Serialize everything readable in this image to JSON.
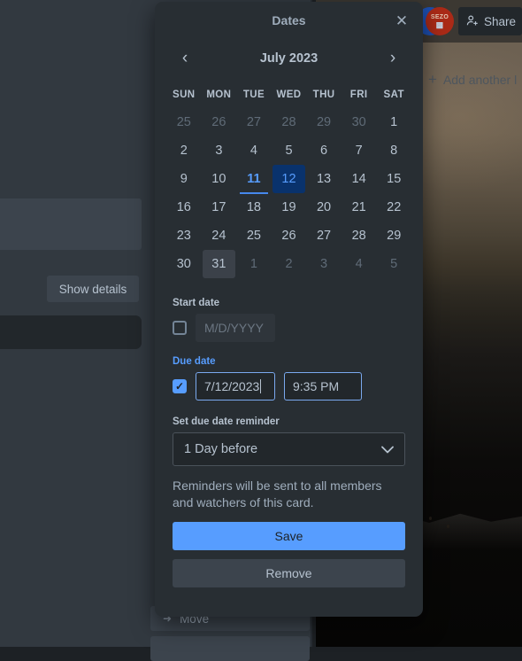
{
  "background": {
    "share_label": "Share",
    "share_icon": "person-plus-icon",
    "add_another_label": "Add another l",
    "add_another_icon": "plus-icon",
    "show_details_label": "Show details",
    "avatar_red_initials": "SEZO",
    "avatar_red_crest": "▩",
    "menu_items": [
      {
        "label": "Move",
        "icon": "arrow-right-icon"
      },
      {
        "label": "",
        "icon": ""
      }
    ]
  },
  "popup": {
    "title": "Dates",
    "close_icon": "close-icon",
    "calendar": {
      "month_label": "July 2023",
      "prev_icon": "chevron-left-icon",
      "next_icon": "chevron-right-icon",
      "weekdays": [
        "SUN",
        "MON",
        "TUE",
        "WED",
        "THU",
        "FRI",
        "SAT"
      ],
      "weeks": [
        [
          {
            "d": "25",
            "state": "muted"
          },
          {
            "d": "26",
            "state": "muted"
          },
          {
            "d": "27",
            "state": "muted"
          },
          {
            "d": "28",
            "state": "muted"
          },
          {
            "d": "29",
            "state": "muted"
          },
          {
            "d": "30",
            "state": "muted"
          },
          {
            "d": "1",
            "state": "normal"
          }
        ],
        [
          {
            "d": "2",
            "state": "normal"
          },
          {
            "d": "3",
            "state": "normal"
          },
          {
            "d": "4",
            "state": "normal"
          },
          {
            "d": "5",
            "state": "normal"
          },
          {
            "d": "6",
            "state": "normal"
          },
          {
            "d": "7",
            "state": "normal"
          },
          {
            "d": "8",
            "state": "normal"
          }
        ],
        [
          {
            "d": "9",
            "state": "normal"
          },
          {
            "d": "10",
            "state": "normal"
          },
          {
            "d": "11",
            "state": "today"
          },
          {
            "d": "12",
            "state": "selected"
          },
          {
            "d": "13",
            "state": "normal"
          },
          {
            "d": "14",
            "state": "normal"
          },
          {
            "d": "15",
            "state": "normal"
          }
        ],
        [
          {
            "d": "16",
            "state": "normal"
          },
          {
            "d": "17",
            "state": "normal"
          },
          {
            "d": "18",
            "state": "normal"
          },
          {
            "d": "19",
            "state": "normal"
          },
          {
            "d": "20",
            "state": "normal"
          },
          {
            "d": "21",
            "state": "normal"
          },
          {
            "d": "22",
            "state": "normal"
          }
        ],
        [
          {
            "d": "23",
            "state": "normal"
          },
          {
            "d": "24",
            "state": "normal"
          },
          {
            "d": "25",
            "state": "normal"
          },
          {
            "d": "26",
            "state": "normal"
          },
          {
            "d": "27",
            "state": "normal"
          },
          {
            "d": "28",
            "state": "normal"
          },
          {
            "d": "29",
            "state": "normal"
          }
        ],
        [
          {
            "d": "30",
            "state": "normal"
          },
          {
            "d": "31",
            "state": "hovered"
          },
          {
            "d": "1",
            "state": "muted"
          },
          {
            "d": "2",
            "state": "muted"
          },
          {
            "d": "3",
            "state": "muted"
          },
          {
            "d": "4",
            "state": "muted"
          },
          {
            "d": "5",
            "state": "muted"
          }
        ]
      ]
    },
    "start_date": {
      "label": "Start date",
      "checked": false,
      "placeholder": "M/D/YYYY",
      "value": ""
    },
    "due_date": {
      "label": "Due date",
      "checked": true,
      "check_glyph": "✓",
      "date_value": "7/12/2023",
      "time_value": "9:35 PM"
    },
    "reminder": {
      "label": "Set due date reminder",
      "selected": "1 Day before",
      "chevron_icon": "chevron-down-icon"
    },
    "hint": "Reminders will be sent to all members and watchers of this card.",
    "save_label": "Save",
    "remove_label": "Remove"
  },
  "colors": {
    "accent": "#579dff",
    "selected_day_bg": "#09326c",
    "popup_bg": "#282e33",
    "panel_bg": "#323940",
    "input_bg": "#22272b"
  }
}
